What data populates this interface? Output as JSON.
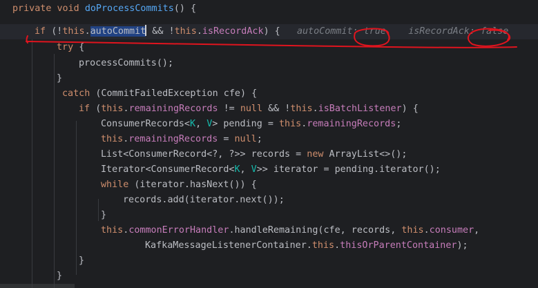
{
  "editor": {
    "lines": [
      {
        "tokens": [
          {
            "t": "kw",
            "v": "private "
          },
          {
            "t": "kw",
            "v": "void "
          },
          {
            "t": "fn",
            "v": "doProcessCommits"
          },
          {
            "t": "pl",
            "v": "() {"
          }
        ]
      },
      {
        "tokens": [
          {
            "t": "kw",
            "v": "if "
          },
          {
            "t": "pl",
            "v": "(!"
          },
          {
            "t": "kw",
            "v": "this"
          },
          {
            "t": "pl",
            "v": "."
          },
          {
            "t": "sel",
            "v": "autoCommit"
          },
          {
            "t": "caret",
            "v": ""
          },
          {
            "t": "pl",
            "v": " && !"
          },
          {
            "t": "kw",
            "v": "this"
          },
          {
            "t": "pl",
            "v": "."
          },
          {
            "t": "fld",
            "v": "isRecordAck"
          },
          {
            "t": "pl",
            "v": ") {   "
          },
          {
            "t": "hint-label",
            "v": "autoCommit: "
          },
          {
            "t": "hint-val",
            "v": "true"
          },
          {
            "t": "pl",
            "v": "    "
          },
          {
            "t": "hint-label",
            "v": "isRecordAck: "
          },
          {
            "t": "hint-val",
            "v": "false"
          }
        ]
      },
      {
        "tokens": [
          {
            "t": "kw",
            "v": "try "
          },
          {
            "t": "pl",
            "v": "{"
          }
        ]
      },
      {
        "tokens": [
          {
            "t": "pl",
            "v": "processCommits();"
          }
        ]
      },
      {
        "tokens": [
          {
            "t": "pl",
            "v": "}"
          }
        ]
      },
      {
        "tokens": [
          {
            "t": "kw",
            "v": "catch "
          },
          {
            "t": "pl",
            "v": "(CommitFailedException cfe) {"
          }
        ]
      },
      {
        "tokens": [
          {
            "t": "kw",
            "v": "if "
          },
          {
            "t": "pl",
            "v": "("
          },
          {
            "t": "kw",
            "v": "this"
          },
          {
            "t": "pl",
            "v": "."
          },
          {
            "t": "fld",
            "v": "remainingRecords"
          },
          {
            "t": "pl",
            "v": " != "
          },
          {
            "t": "kw",
            "v": "null "
          },
          {
            "t": "pl",
            "v": "&& !"
          },
          {
            "t": "kw",
            "v": "this"
          },
          {
            "t": "pl",
            "v": "."
          },
          {
            "t": "fld",
            "v": "isBatchListener"
          },
          {
            "t": "pl",
            "v": ") {"
          }
        ]
      },
      {
        "tokens": [
          {
            "t": "pl",
            "v": "ConsumerRecords<"
          },
          {
            "t": "tp",
            "v": "K"
          },
          {
            "t": "pl",
            "v": ", "
          },
          {
            "t": "tp",
            "v": "V"
          },
          {
            "t": "pl",
            "v": "> pending = "
          },
          {
            "t": "kw",
            "v": "this"
          },
          {
            "t": "pl",
            "v": "."
          },
          {
            "t": "fld",
            "v": "remainingRecords"
          },
          {
            "t": "pl",
            "v": ";"
          }
        ]
      },
      {
        "tokens": [
          {
            "t": "kw",
            "v": "this"
          },
          {
            "t": "pl",
            "v": "."
          },
          {
            "t": "fld",
            "v": "remainingRecords"
          },
          {
            "t": "pl",
            "v": " = "
          },
          {
            "t": "kw",
            "v": "null"
          },
          {
            "t": "pl",
            "v": ";"
          }
        ]
      },
      {
        "tokens": [
          {
            "t": "pl",
            "v": "List<ConsumerRecord<?, ?>> records = "
          },
          {
            "t": "kw",
            "v": "new "
          },
          {
            "t": "pl",
            "v": "ArrayList<>();"
          }
        ]
      },
      {
        "tokens": [
          {
            "t": "pl",
            "v": "Iterator<ConsumerRecord<"
          },
          {
            "t": "tp",
            "v": "K"
          },
          {
            "t": "pl",
            "v": ", "
          },
          {
            "t": "tp",
            "v": "V"
          },
          {
            "t": "pl",
            "v": ">> iterator = pending.iterator();"
          }
        ]
      },
      {
        "tokens": [
          {
            "t": "kw",
            "v": "while "
          },
          {
            "t": "pl",
            "v": "(iterator.hasNext()) {"
          }
        ]
      },
      {
        "tokens": [
          {
            "t": "pl",
            "v": "records.add(iterator.next());"
          }
        ]
      },
      {
        "tokens": [
          {
            "t": "pl",
            "v": "}"
          }
        ]
      },
      {
        "tokens": [
          {
            "t": "kw",
            "v": "this"
          },
          {
            "t": "pl",
            "v": "."
          },
          {
            "t": "fld",
            "v": "commonErrorHandler"
          },
          {
            "t": "pl",
            "v": ".handleRemaining(cfe, records, "
          },
          {
            "t": "kw",
            "v": "this"
          },
          {
            "t": "pl",
            "v": "."
          },
          {
            "t": "fld",
            "v": "consumer"
          },
          {
            "t": "pl",
            "v": ","
          }
        ]
      },
      {
        "tokens": [
          {
            "t": "pl",
            "v": "KafkaMessageListenerContainer."
          },
          {
            "t": "kw",
            "v": "this"
          },
          {
            "t": "pl",
            "v": "."
          },
          {
            "t": "fld",
            "v": "thisOrParentContainer"
          },
          {
            "t": "pl",
            "v": ");"
          }
        ]
      },
      {
        "tokens": [
          {
            "t": "pl",
            "v": "}"
          }
        ]
      },
      {
        "tokens": [
          {
            "t": "pl",
            "v": "}"
          }
        ]
      }
    ]
  },
  "colors": {
    "background": "#1e1f22",
    "keyword": "#cf8e6d",
    "method": "#56a8f5",
    "field": "#c77dbb",
    "type_param": "#16baac",
    "annotation_ink": "#e0141e"
  }
}
